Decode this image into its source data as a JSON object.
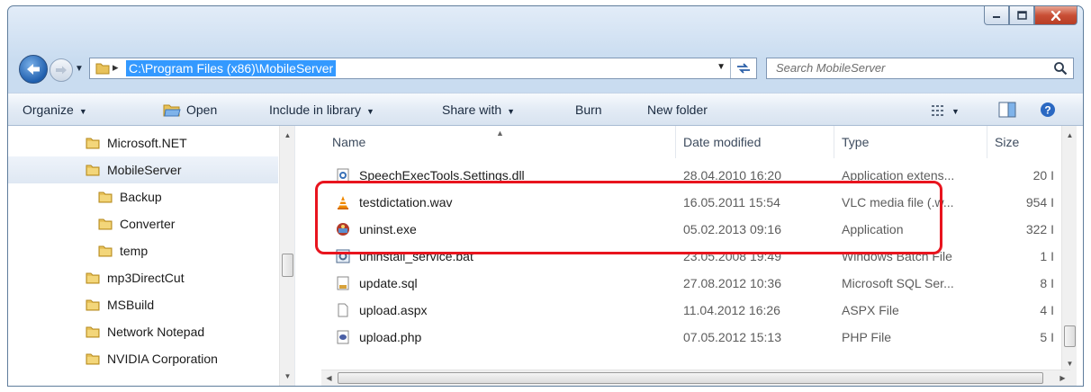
{
  "window": {
    "controls": [
      "minimize-icon",
      "maximize-icon",
      "close-icon"
    ]
  },
  "address": {
    "path": "C:\\Program Files (x86)\\MobileServer",
    "separator": "▸",
    "search_placeholder": "Search MobileServer"
  },
  "toolbar": {
    "organize": "Organize",
    "open": "Open",
    "include": "Include in library",
    "share": "Share with",
    "burn": "Burn",
    "new_folder": "New folder"
  },
  "nav": {
    "items": [
      {
        "label": "Microsoft.NET",
        "indent": 0,
        "selected": false
      },
      {
        "label": "MobileServer",
        "indent": 0,
        "selected": true
      },
      {
        "label": "Backup",
        "indent": 1,
        "selected": false
      },
      {
        "label": "Converter",
        "indent": 1,
        "selected": false
      },
      {
        "label": "temp",
        "indent": 1,
        "selected": false
      },
      {
        "label": "mp3DirectCut",
        "indent": 0,
        "selected": false
      },
      {
        "label": "MSBuild",
        "indent": 0,
        "selected": false
      },
      {
        "label": "Network Notepad",
        "indent": 0,
        "selected": false
      },
      {
        "label": "NVIDIA Corporation",
        "indent": 0,
        "selected": false
      }
    ]
  },
  "columns": {
    "name": "Name",
    "date": "Date modified",
    "type": "Type",
    "size": "Size"
  },
  "files": [
    {
      "name": "SpeechExecTools.Settings.dll",
      "date": "28.04.2010 16:20",
      "type": "Application extens...",
      "size": "20 I",
      "icon": "dll-gear-icon"
    },
    {
      "name": "testdictation.wav",
      "date": "16.05.2011 15:54",
      "type": "VLC media file (.w...",
      "size": "954 I",
      "icon": "vlc-cone-icon"
    },
    {
      "name": "uninst.exe",
      "date": "05.02.2013 09:16",
      "type": "Application",
      "size": "322 I",
      "icon": "installer-icon"
    },
    {
      "name": "uninstall_service.bat",
      "date": "23.05.2008 19:49",
      "type": "Windows Batch File",
      "size": "1 I",
      "icon": "batch-gear-icon"
    },
    {
      "name": "update.sql",
      "date": "27.08.2012 10:36",
      "type": "Microsoft SQL Ser...",
      "size": "8 I",
      "icon": "sql-document-icon"
    },
    {
      "name": "upload.aspx",
      "date": "11.04.2012 16:26",
      "type": "ASPX File",
      "size": "4 I",
      "icon": "blank-document-icon"
    },
    {
      "name": "upload.php",
      "date": "07.05.2012 15:13",
      "type": "PHP File",
      "size": "5 I",
      "icon": "php-document-icon"
    }
  ],
  "accent": {
    "highlight": "#e8141e",
    "address_selection": "#3399ff"
  }
}
